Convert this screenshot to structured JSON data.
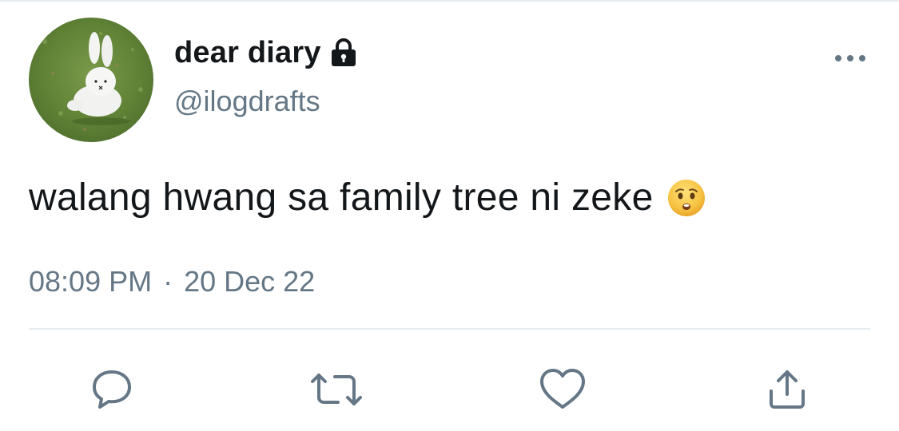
{
  "tweet": {
    "display_name": "dear diary",
    "handle": "@ilogdrafts",
    "text": "walang hwang sa family tree ni zeke",
    "time": "08:09 PM",
    "separator": "·",
    "date": "20 Dec 22",
    "protected_icon": "lock-icon",
    "emoji_icon": "anxious-face-emoji"
  },
  "actions": {
    "reply_icon": "speech-bubble-icon",
    "retweet_icon": "retweet-icon",
    "like_icon": "heart-icon",
    "share_icon": "share-upload-icon"
  },
  "colors": {
    "text_primary": "#14171a",
    "text_secondary": "#657786",
    "divider": "#e6ecf0"
  }
}
